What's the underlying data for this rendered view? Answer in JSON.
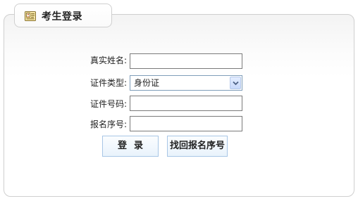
{
  "panel": {
    "title": "考生登录",
    "icon": "id-card-icon"
  },
  "form": {
    "real_name_label": "真实姓名:",
    "real_name_value": "",
    "id_type_label": "证件类型:",
    "id_type_selected": "身份证",
    "id_number_label": "证件号码:",
    "id_number_value": "",
    "reg_number_label": "报名序号:",
    "reg_number_value": ""
  },
  "buttons": {
    "login_label": "登录",
    "retrieve_label": "找回报名序号"
  },
  "colors": {
    "panel_border": "#cfcfcf",
    "button_border": "#a8c6e6",
    "select_arrow": "#4d6185"
  }
}
